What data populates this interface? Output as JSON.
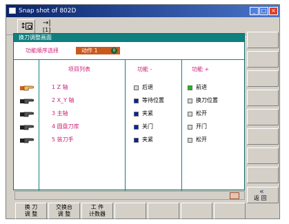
{
  "window": {
    "title": "Snap shot of 802D"
  },
  "toolbar": {
    "tool2_label": "[1]"
  },
  "panel": {
    "title": "换刀调整画面",
    "seq_label": "功能顺序选择",
    "seq_value": "动作 1",
    "headers": {
      "items": "项目列表",
      "minus": "功能 -",
      "plus": "功能 +"
    },
    "items": [
      "1 Z 轴",
      "2 X_Y 轴",
      "3 主轴",
      "4 圆盘刀库",
      "5 装刀手"
    ],
    "minus_funcs": [
      "后退",
      "等待位置",
      "夹紧",
      "关门",
      "夹紧"
    ],
    "plus_funcs": [
      "前进",
      "换刀位置",
      "松开",
      "开门",
      "松开"
    ]
  },
  "softkeys": {
    "k1": [
      "换 刀",
      "调 整"
    ],
    "k2": [
      "交换台",
      "调 整"
    ],
    "k3": [
      "工 件",
      "计数器"
    ],
    "return": "返 回"
  },
  "colors": {
    "accent": "#0f7f7f",
    "pink_text": "#cc2277",
    "active_value_bg": "#c85a1e",
    "blue_indicator": "#0022aa",
    "green_indicator": "#22bb22"
  }
}
